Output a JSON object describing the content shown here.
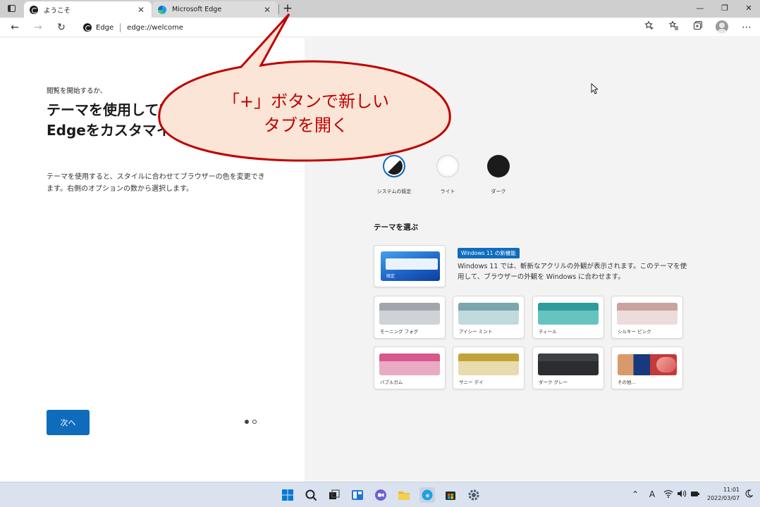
{
  "browser": {
    "tabs": [
      {
        "title": "ようこそ",
        "close": "✕"
      },
      {
        "title": "Microsoft Edge",
        "close": "✕"
      }
    ],
    "new_tab": "+",
    "window_controls": {
      "minimize": "—",
      "restore": "❐",
      "close": "✕"
    },
    "toolbar": {
      "back": "←",
      "forward": "→",
      "refresh": "↻",
      "more": "⋯"
    },
    "address": {
      "site_label": "Edge",
      "url": "edge://welcome"
    }
  },
  "welcome": {
    "kicker": "閲覧を開始するか、",
    "headline": "テーマを使用してMicrosoft Edgeをカスタマイズして表現する",
    "description": "テーマを使用すると、スタイルに合わせてブラウザーの色を変更できます。右側のオプションの数から選択します。",
    "next_button": "次へ",
    "pagination": {
      "current": 1,
      "total": 2
    }
  },
  "appearance": {
    "options": [
      {
        "id": "system",
        "label": "システムの既定"
      },
      {
        "id": "light",
        "label": "ライト"
      },
      {
        "id": "dark",
        "label": "ダーク"
      }
    ],
    "selected": "system"
  },
  "themes": {
    "section_title": "テーマを選ぶ",
    "windows11": {
      "card_label": "既定",
      "badge": "Windows 11 の新機能",
      "description": "Windows 11 では、斬新なアクリルの外観が表示されます。このテーマを使用して、ブラウザーの外観を Windows に合わせます。"
    },
    "items": [
      {
        "label": "モーニング フォグ",
        "color": "#a0a6ab",
        "light": "#cfd3d6"
      },
      {
        "label": "アイシー ミント",
        "color": "#7aa6ad",
        "light": "#c0dadd"
      },
      {
        "label": "ティール",
        "color": "#2e9c9a",
        "light": "#66c3c0"
      },
      {
        "label": "シルキー ピンク",
        "color": "#c9a3a0",
        "light": "#ecdcdb"
      },
      {
        "label": "バブルガム",
        "color": "#d8578c",
        "light": "#e9aac4"
      },
      {
        "label": "サニー デイ",
        "color": "#c4a23a",
        "light": "#e6dcae"
      },
      {
        "label": "ダーク グレー",
        "color": "#3e4144",
        "light": "#2b2d30"
      }
    ],
    "more_label": "その他..."
  },
  "callout": {
    "line1": "「+」ボタンで新しい",
    "line2": "タブを開く",
    "fill": "#fbe5d6",
    "stroke": "#c00000",
    "text_color": "#c00000"
  },
  "taskbar": {
    "clock_time": "11:01",
    "clock_date": "2022/03/07",
    "ime": "A"
  },
  "colors": {
    "accent": "#0f6cbd"
  }
}
